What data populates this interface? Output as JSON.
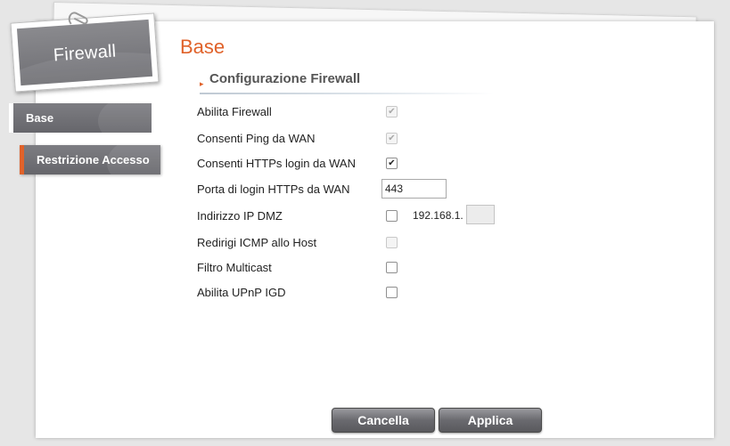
{
  "tag": {
    "title": "Firewall"
  },
  "sidebar": {
    "items": [
      {
        "label": "Base"
      },
      {
        "label": "Restrizione Accesso"
      }
    ]
  },
  "page": {
    "title": "Base"
  },
  "section": {
    "title": "Configurazione Firewall"
  },
  "fields": [
    {
      "label": "Abilita Firewall",
      "checked": true,
      "disabled": true
    },
    {
      "label": "Consenti Ping da WAN",
      "checked": true,
      "disabled": true
    },
    {
      "label": "Consenti HTTPs login da WAN",
      "checked": true,
      "disabled": false
    },
    {
      "label": "Porta di login HTTPs da WAN",
      "value": "443"
    },
    {
      "label": "Indirizzo IP DMZ",
      "checked": false,
      "ip_prefix": "192.168.1.",
      "ip_value": ""
    },
    {
      "label": "Redirigi ICMP allo Host",
      "checked": false,
      "disabled": true
    },
    {
      "label": "Filtro Multicast",
      "checked": false,
      "disabled": false
    },
    {
      "label": "Abilita UPnP IGD",
      "checked": false,
      "disabled": false
    }
  ],
  "buttons": {
    "cancel": "Cancella",
    "apply": "Applica"
  },
  "colors": {
    "accent": "#e0622a",
    "menu": "#6f6f74",
    "button": "#66666b"
  }
}
